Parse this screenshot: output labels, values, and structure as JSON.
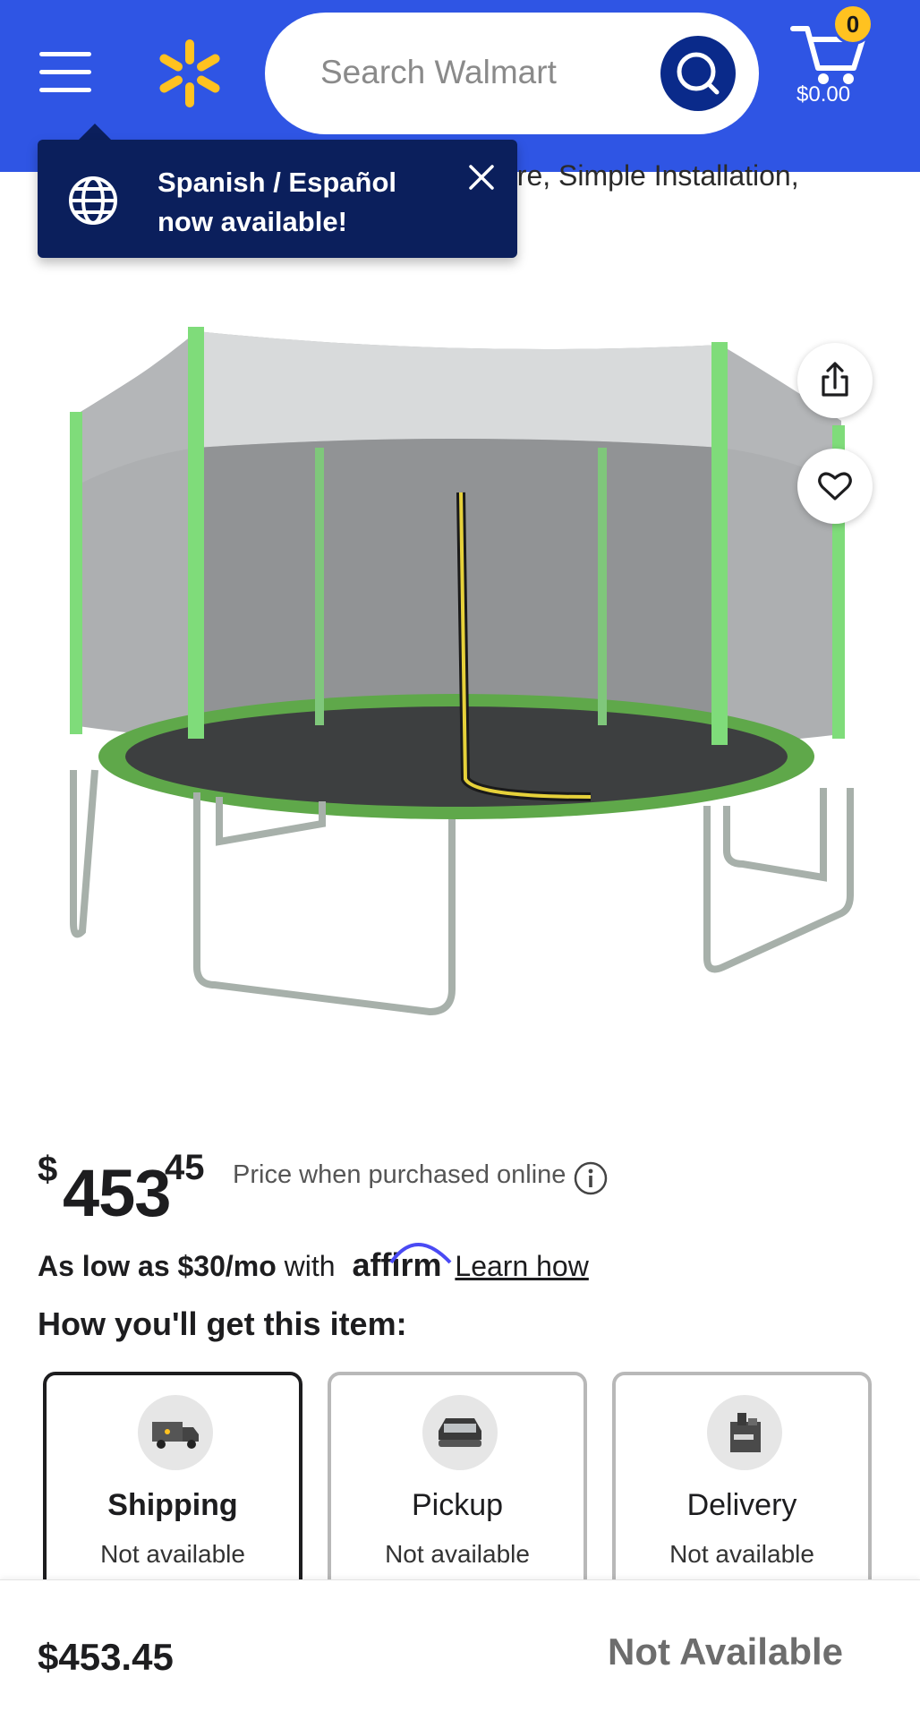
{
  "header": {
    "search_placeholder": "Search Walmart",
    "cart_count": "0",
    "cart_total": "$0.00",
    "icons": [
      "menu-icon",
      "walmart-spark-icon",
      "search-icon",
      "cart-icon"
    ],
    "colors": {
      "header_bg": "#2f55e4",
      "spark": "#ffc220",
      "search_button": "#0a2a8a"
    }
  },
  "product": {
    "title_fragment": "ure, Simple Installation,"
  },
  "toast": {
    "line1": "Spanish / Español",
    "line2": "now available!",
    "icons": [
      "globe-icon",
      "close-icon"
    ]
  },
  "image_actions": [
    "share-icon",
    "heart-icon"
  ],
  "price": {
    "currency": "$",
    "whole": "453",
    "cents": "45",
    "note": "Price when purchased online"
  },
  "financing": {
    "lead": "As low as $30/mo",
    "with": "with",
    "brand": "affirm",
    "link": "Learn how"
  },
  "fulfillment": {
    "heading": "How you'll get this item:",
    "options": [
      {
        "title": "Shipping",
        "status": "Not available",
        "selected": true,
        "icon": "truck-icon"
      },
      {
        "title": "Pickup",
        "status": "Not available",
        "selected": false,
        "icon": "car-icon"
      },
      {
        "title": "Delivery",
        "status": "Not available",
        "selected": false,
        "icon": "bag-icon"
      }
    ]
  },
  "bottom_bar": {
    "price": "$453.45",
    "status": "Not Available"
  }
}
